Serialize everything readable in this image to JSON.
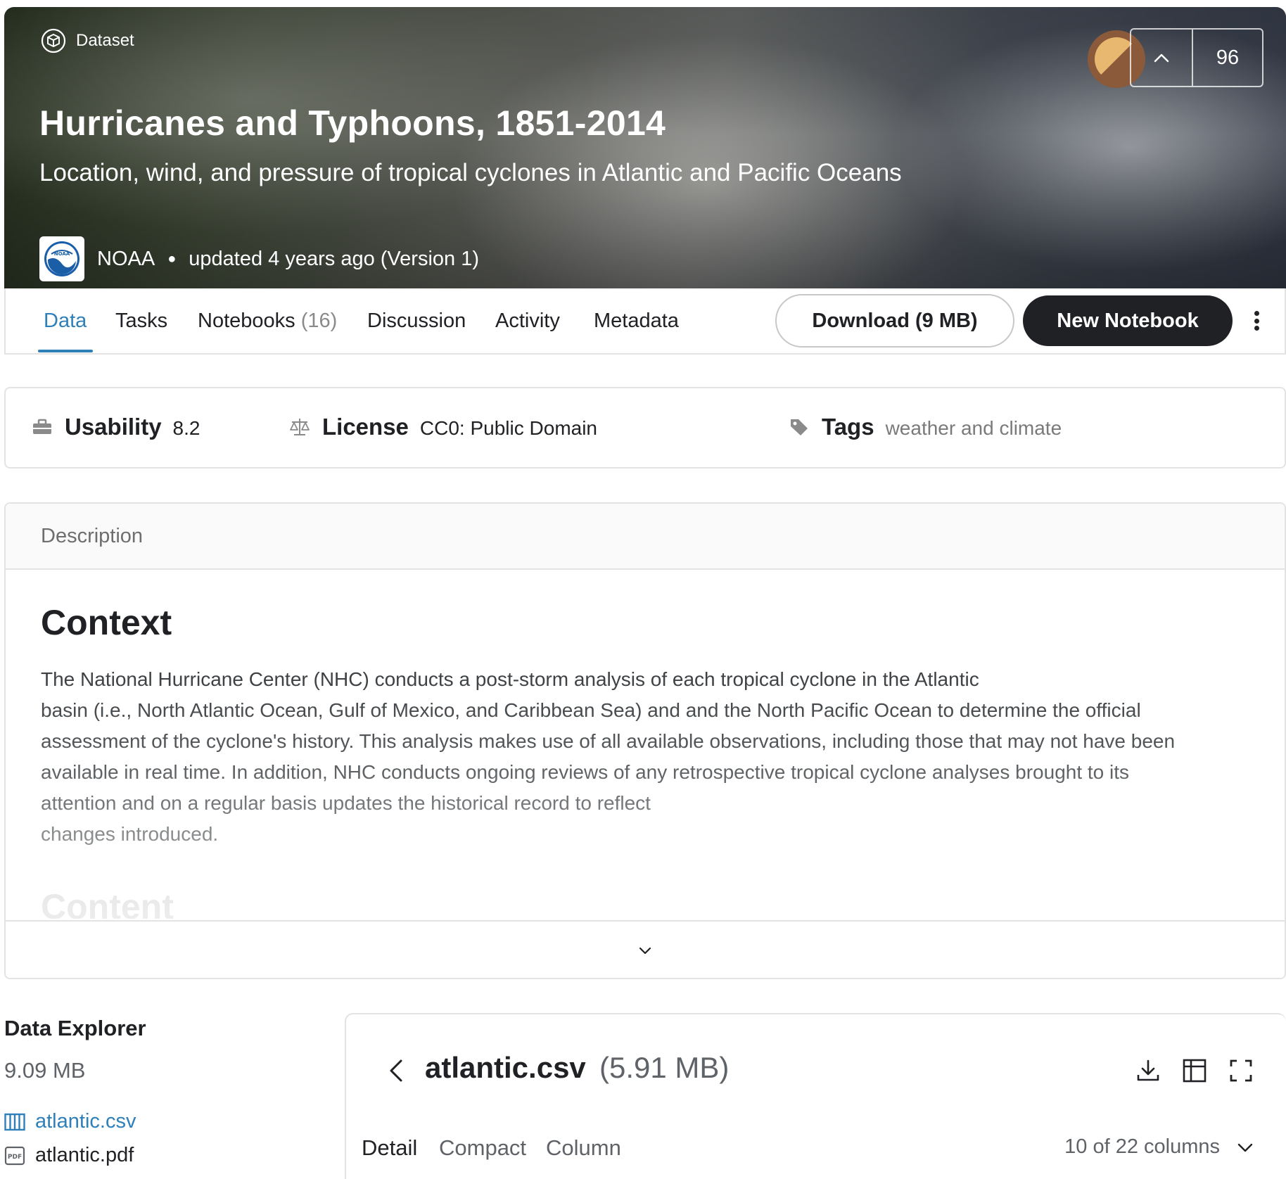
{
  "hero": {
    "type_label": "Dataset",
    "title": "Hurricanes and Typhoons, 1851-2014",
    "subtitle": "Location, wind, and pressure of tropical cyclones in Atlantic and Pacific Oceans",
    "owner": "NOAA",
    "owner_logo_text": "NOAA",
    "updated": "updated 4 years ago (Version 1)",
    "upvotes": "96"
  },
  "tabs": {
    "data": "Data",
    "tasks": "Tasks",
    "notebooks": "Notebooks",
    "notebooks_count": "(16)",
    "discussion": "Discussion",
    "activity": "Activity",
    "metadata": "Metadata"
  },
  "actions": {
    "download": "Download (9 MB)",
    "new_notebook": "New Notebook"
  },
  "meta": {
    "usability_label": "Usability",
    "usability_value": "8.2",
    "license_label": "License",
    "license_value": "CC0: Public Domain",
    "tags_label": "Tags",
    "tags_value": "weather and climate"
  },
  "description": {
    "header": "Description",
    "heading": "Context",
    "lines": [
      "The National Hurricane Center (NHC) conducts a post-storm analysis of each tropical cyclone in the Atlantic",
      "basin (i.e., North Atlantic Ocean, Gulf of Mexico, and Caribbean Sea) and and the North Pacific Ocean to determine the official",
      "assessment of the cyclone's history. This analysis makes use of all available observations, including those that may not have been",
      "available in real time. In addition, NHC conducts ongoing reviews of any retrospective tropical cyclone analyses brought to its",
      "attention and on a regular basis updates the historical record to reflect",
      "changes introduced."
    ],
    "next_heading": "Content"
  },
  "explorer": {
    "title": "Data Explorer",
    "total_size": "9.09 MB",
    "files": [
      "atlantic.csv",
      "atlantic.pdf"
    ],
    "file_icons": [
      "table-icon",
      "pdf-icon"
    ]
  },
  "viewer": {
    "file_name": "atlantic.csv",
    "file_size": "(5.91 MB)",
    "tabs": [
      "Detail",
      "Compact",
      "Column"
    ],
    "columns_summary": "10 of 22 columns"
  },
  "colors": {
    "accent": "#2f7fb9",
    "dark_button": "#202124",
    "border": "#e3e3e3"
  }
}
